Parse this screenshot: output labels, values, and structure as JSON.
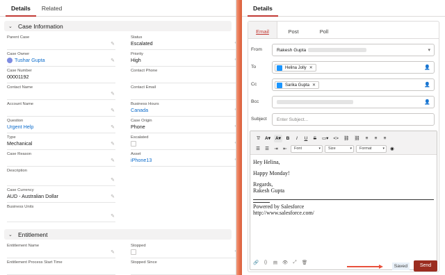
{
  "left_panel": {
    "tabs": [
      {
        "label": "Details",
        "active": true
      },
      {
        "label": "Related",
        "active": false
      }
    ],
    "case_info": {
      "title": "Case Information",
      "fields_left": [
        {
          "label": "Parent Case",
          "value": ""
        },
        {
          "label": "Case Owner",
          "value": "Tushar Gupta",
          "link": true
        },
        {
          "label": "Case Number",
          "value": "00001192"
        },
        {
          "label": "Contact Name",
          "value": ""
        },
        {
          "label": "Account Name",
          "value": ""
        },
        {
          "label": "Question",
          "value": "Urgent Help",
          "link": true
        },
        {
          "label": "Type",
          "value": "Mechanical"
        },
        {
          "label": "Case Reason",
          "value": ""
        },
        {
          "label": "Description",
          "value": ""
        },
        {
          "label": "Case Currency",
          "value": "AUD - Australian Dollar"
        },
        {
          "label": "Business Units",
          "value": ""
        }
      ],
      "fields_right": [
        {
          "label": "Status",
          "value": "Escalated"
        },
        {
          "label": "Priority",
          "value": "High"
        },
        {
          "label": "Contact Phone",
          "value": ""
        },
        {
          "label": "Contact Email",
          "value": ""
        },
        {
          "label": "Business Hours",
          "value": "Canada",
          "link": true
        },
        {
          "label": "Case Origin",
          "value": "Phone"
        },
        {
          "label": "Escalated",
          "value": ""
        },
        {
          "label": "Asset",
          "value": "iPhone13",
          "link": true
        }
      ]
    },
    "entitlement": {
      "title": "Entitlement",
      "fields_left": [
        {
          "label": "Entitlement Name",
          "value": ""
        },
        {
          "label": "Entitlement Process Start Time",
          "value": ""
        }
      ],
      "fields_right": [
        {
          "label": "Stopped",
          "value": ""
        },
        {
          "label": "Stopped Since",
          "value": ""
        }
      ]
    }
  },
  "right_panel": {
    "tab": "Details",
    "publisher_tabs": [
      "Email",
      "Post",
      "Poll"
    ],
    "from": {
      "label": "From",
      "value": "Rakesh Gupta"
    },
    "to": {
      "label": "To",
      "recipient": "Helina Jolly"
    },
    "cc": {
      "label": "Cc",
      "recipient": "Sarika Gupta"
    },
    "bcc": {
      "label": "Bcc"
    },
    "subject": {
      "label": "Subject",
      "placeholder": "Enter Subject..."
    },
    "toolbar": {
      "font": "Font",
      "size": "Size",
      "format": "Format"
    },
    "body": {
      "greeting": "Hey Helina,",
      "line1": "Happy Monday!",
      "regards": "Regards,",
      "name": "Rakesh Gupta",
      "powered": "Powered by Salesforce",
      "url": "http://www.salesforce.com/"
    },
    "saved_label": "Saved",
    "send_label": "Send"
  },
  "colors": {
    "accent_red": "#c23934",
    "link_blue": "#0b6bcb",
    "send_bg": "#9b2c1f",
    "divider": "#e8734f"
  }
}
